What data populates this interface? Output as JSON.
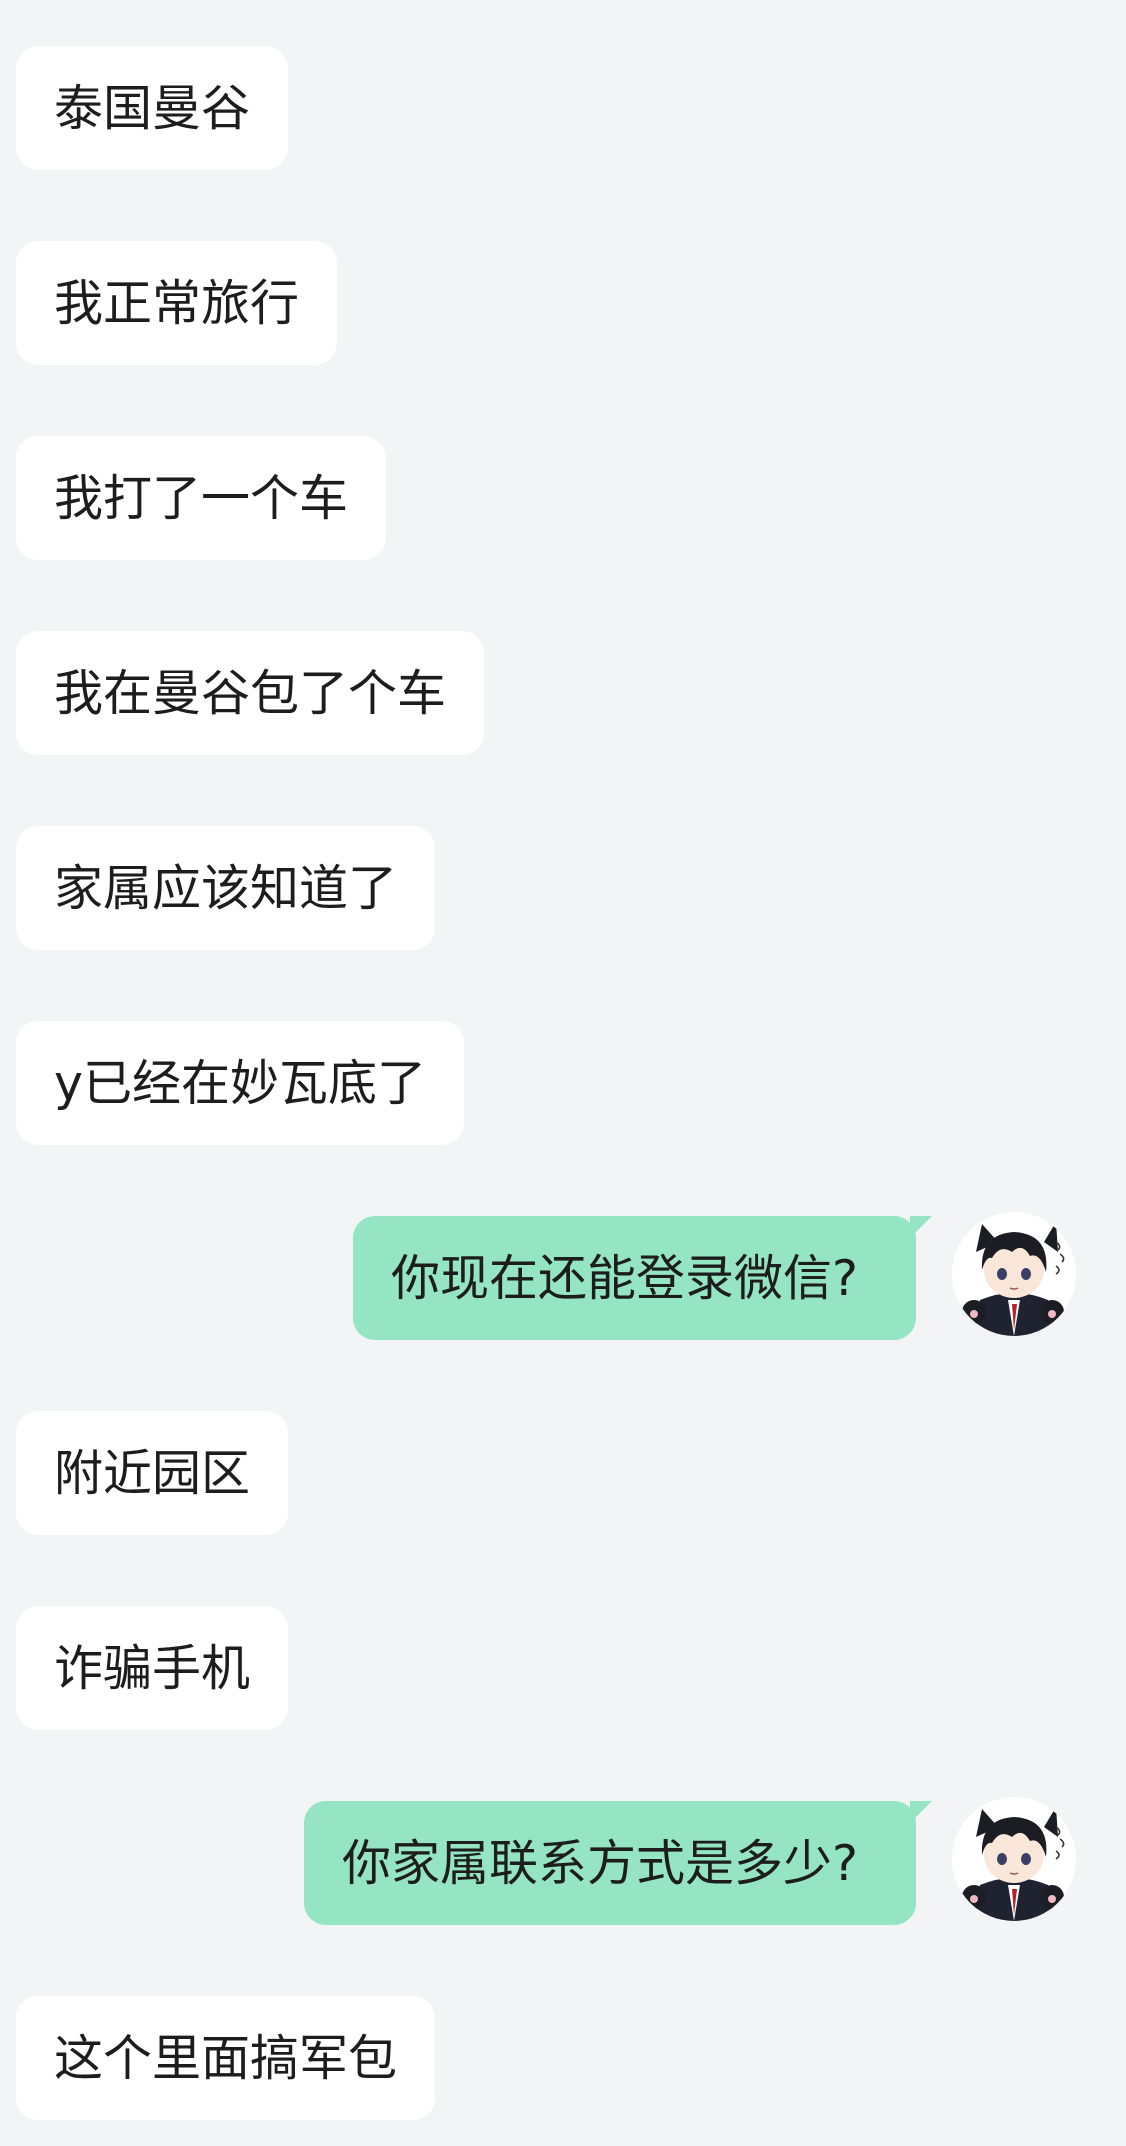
{
  "conversation": {
    "messages": [
      {
        "side": "incoming",
        "text": "泰国曼谷"
      },
      {
        "side": "incoming",
        "text": "我正常旅行"
      },
      {
        "side": "incoming",
        "text": "我打了一个车"
      },
      {
        "side": "incoming",
        "text": "我在曼谷包了个车"
      },
      {
        "side": "incoming",
        "text": "家属应该知道了"
      },
      {
        "side": "incoming",
        "text": "y已经在妙瓦底了"
      },
      {
        "side": "outgoing",
        "text": "你现在还能登录微信?",
        "avatar": "anime-boy-cat-ears-avatar"
      },
      {
        "side": "incoming",
        "text": "附近园区"
      },
      {
        "side": "incoming",
        "text": "诈骗手机"
      },
      {
        "side": "outgoing",
        "text": "你家属联系方式是多少?",
        "avatar": "anime-boy-cat-ears-avatar"
      },
      {
        "side": "incoming",
        "text": "这个里面搞军包"
      }
    ]
  },
  "colors": {
    "background": "#f3f4f5",
    "incoming_bubble": "#ffffff",
    "outgoing_bubble": "#95e5c5",
    "text": "#1d1d1d"
  }
}
